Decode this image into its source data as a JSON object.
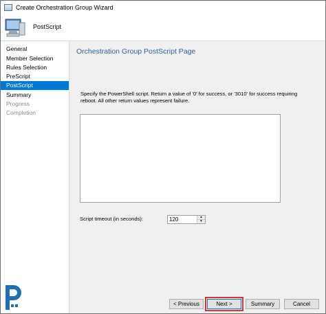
{
  "window": {
    "title": "Create Orchestration Group Wizard"
  },
  "header": {
    "title": "PostScript",
    "icon": "computer-icon"
  },
  "nav": {
    "items": [
      {
        "label": "General",
        "state": "normal"
      },
      {
        "label": "Member Selection",
        "state": "normal"
      },
      {
        "label": "Rules Selection",
        "state": "normal"
      },
      {
        "label": "PreScript",
        "state": "normal"
      },
      {
        "label": "PostScript",
        "state": "active"
      },
      {
        "label": "Summary",
        "state": "normal"
      },
      {
        "label": "Progress",
        "state": "disabled"
      },
      {
        "label": "Completion",
        "state": "disabled"
      }
    ]
  },
  "main": {
    "page_title": "Orchestration Group PostScript Page",
    "description": "Specify the PowerShell script. Return a value of '0' for success, or '3010' for success requiring reboot. All other return values represent failure.",
    "script_value": "",
    "timeout_label": "Script timeout (in seconds):",
    "timeout_value": "120"
  },
  "buttons": {
    "previous": "< Previous",
    "next": "Next >",
    "summary": "Summary",
    "cancel": "Cancel"
  },
  "colors": {
    "accent": "#0078d7",
    "title_blue": "#2d63a4",
    "highlight": "#e0312e"
  }
}
